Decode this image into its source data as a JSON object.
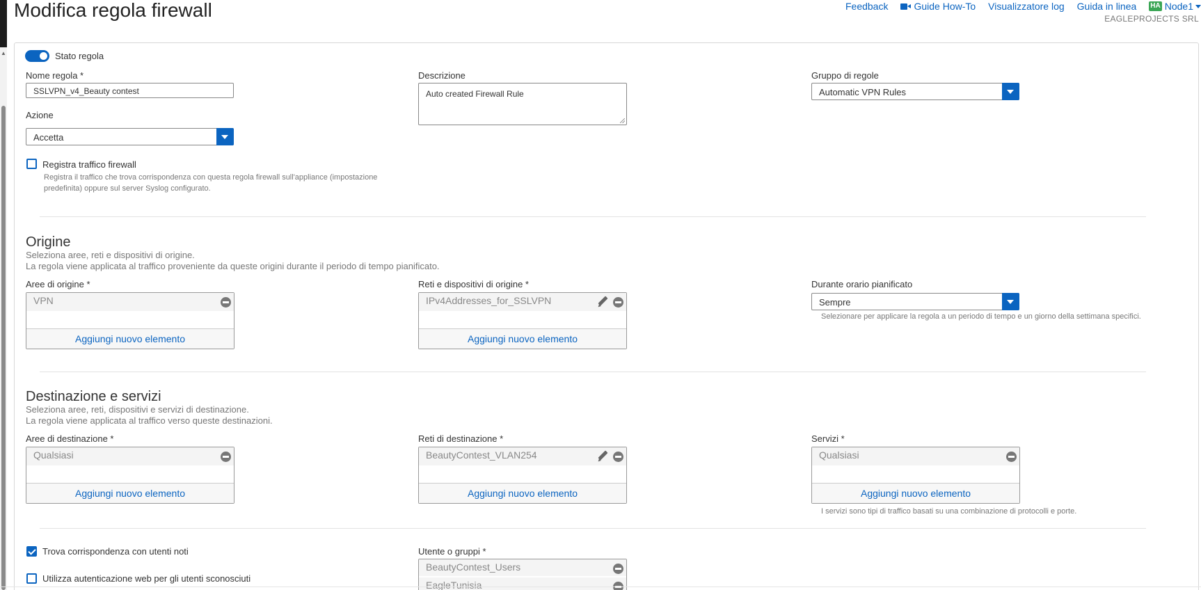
{
  "header": {
    "title": "Modifica regola firewall",
    "links": {
      "feedback": "Feedback",
      "guide": "Guide How-To",
      "log_viewer": "Visualizzatore log",
      "online_help": "Guida in linea",
      "ha_badge": "HA",
      "node": "Node1"
    },
    "company": "EAGLEPROJECTS SRL"
  },
  "form": {
    "state_label": "Stato regola",
    "name_label": "Nome regola *",
    "name_value": "SSLVPN_v4_Beauty contest",
    "description_label": "Descrizione",
    "description_value": "Auto created Firewall Rule",
    "group_label": "Gruppo di regole",
    "group_value": "Automatic VPN Rules",
    "action_label": "Azione",
    "action_value": "Accetta",
    "log_label": "Registra traffico firewall",
    "log_help_line1": "Registra il traffico che trova corrispondenza con questa regola firewall sull'appliance (impostazione",
    "log_help_line2": "predefinita) oppure sul server Syslog configurato."
  },
  "origin": {
    "title": "Origine",
    "desc1": "Seleziona aree, reti e dispositivi di origine.",
    "desc2": "La regola viene applicata al traffico proveniente da queste origini durante il periodo di tempo pianificato.",
    "zones_label": "Aree di origine *",
    "zones_item": "VPN",
    "networks_label": "Reti e dispositivi di origine *",
    "networks_item": "IPv4Addresses_for_SSLVPN",
    "schedule_label": "Durante orario pianificato",
    "schedule_value": "Sempre",
    "schedule_help": "Selezionare per applicare la regola a un periodo di tempo e un giorno della settimana specifici."
  },
  "destination": {
    "title": "Destinazione e servizi",
    "desc1": "Seleziona aree, reti, dispositivi e servizi di destinazione.",
    "desc2": "La regola viene applicata al traffico verso queste destinazioni.",
    "zones_label": "Aree di destinazione *",
    "zones_item": "Qualsiasi",
    "networks_label": "Reti di destinazione *",
    "networks_item": "BeautyContest_VLAN254",
    "services_label": "Servizi *",
    "services_item": "Qualsiasi",
    "services_help": "I servizi sono tipi di traffico basati su una combinazione di protocolli e porte."
  },
  "add_item_label": "Aggiungi nuovo elemento",
  "users": {
    "match_known_label": "Trova corrispondenza con utenti noti",
    "web_auth_label": "Utilizza autenticazione web per gli utenti sconosciuti",
    "users_label": "Utente o gruppi *",
    "user_items": [
      "BeautyContest_Users",
      "EagleTunisia"
    ]
  }
}
